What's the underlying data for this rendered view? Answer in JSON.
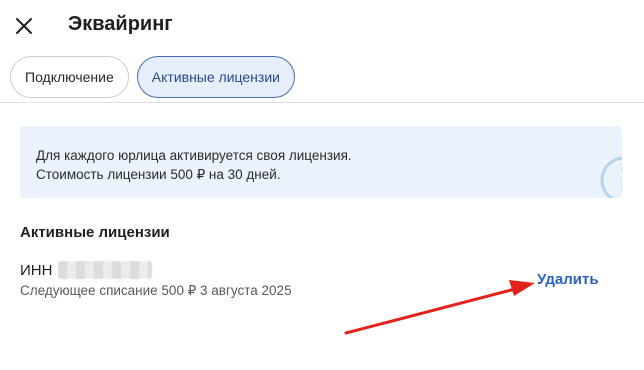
{
  "header": {
    "title": "Эквайринг",
    "close_icon": "close-icon"
  },
  "tabs": [
    {
      "label": "Подключение",
      "active": false
    },
    {
      "label": "Активные лицензии",
      "active": true
    }
  ],
  "info_banner": {
    "line1": "Для каждого юрлица активируется своя лицензия.",
    "line2": "Стоимость лицензии 500 ₽ на 30 дней.",
    "icon": "info-icon"
  },
  "licenses": {
    "section_title": "Активные лицензии",
    "items": [
      {
        "inn_label": "ИНН",
        "next_charge": "Следующее списание 500 ₽ 3 августа 2025",
        "delete_label": "Удалить"
      }
    ]
  },
  "colors": {
    "accent": "#2a62c5",
    "annotation_arrow": "#e3231b",
    "active_tab_bg": "#e7eefb",
    "info_bg": "#eaf2fb"
  }
}
